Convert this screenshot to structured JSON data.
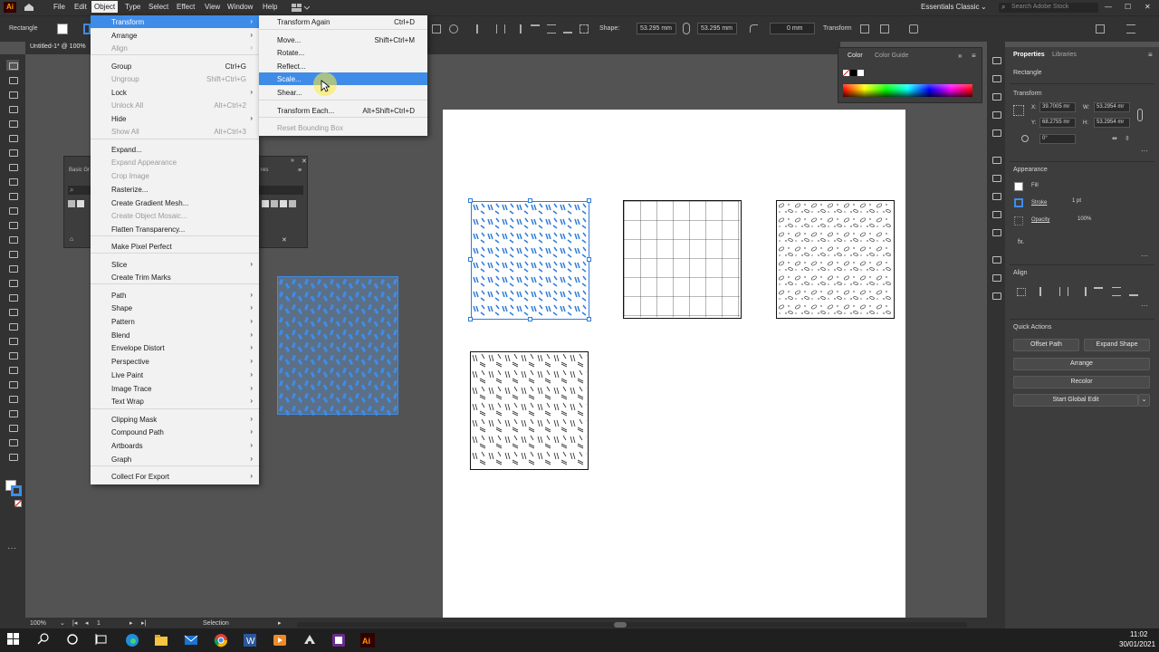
{
  "app": {
    "logo": "Ai",
    "workspace": "Essentials Classic",
    "search_placeholder": "Search Adobe Stock",
    "doc_tab": "Untitled-1* @ 100%"
  },
  "menubar": [
    "File",
    "Edit",
    "Object",
    "Type",
    "Select",
    "Effect",
    "View",
    "Window",
    "Help"
  ],
  "control": {
    "selection_type": "Rectangle",
    "shape_label": "Shape:",
    "w_value": "53.295 mm",
    "h_value": "53.295 mm",
    "corner_value": "0 mm",
    "transform_label": "Transform"
  },
  "object_menu": {
    "items": [
      {
        "label": "Transform",
        "shortcut": "",
        "arrow": "›",
        "state": "highlight"
      },
      {
        "label": "Arrange",
        "shortcut": "",
        "arrow": "›",
        "state": "normal"
      },
      {
        "label": "Align",
        "shortcut": "",
        "arrow": "›",
        "state": "disabled"
      },
      {
        "label": "Group",
        "shortcut": "Ctrl+G",
        "arrow": "",
        "state": "normal"
      },
      {
        "label": "Ungroup",
        "shortcut": "Shift+Ctrl+G",
        "arrow": "",
        "state": "disabled"
      },
      {
        "label": "Lock",
        "shortcut": "",
        "arrow": "›",
        "state": "normal"
      },
      {
        "label": "Unlock All",
        "shortcut": "Alt+Ctrl+2",
        "arrow": "",
        "state": "disabled"
      },
      {
        "label": "Hide",
        "shortcut": "",
        "arrow": "›",
        "state": "normal"
      },
      {
        "label": "Show All",
        "shortcut": "Alt+Ctrl+3",
        "arrow": "",
        "state": "disabled"
      },
      {
        "label": "Expand...",
        "shortcut": "",
        "arrow": "",
        "state": "normal"
      },
      {
        "label": "Expand Appearance",
        "shortcut": "",
        "arrow": "",
        "state": "disabled"
      },
      {
        "label": "Crop Image",
        "shortcut": "",
        "arrow": "",
        "state": "disabled"
      },
      {
        "label": "Rasterize...",
        "shortcut": "",
        "arrow": "",
        "state": "normal"
      },
      {
        "label": "Create Gradient Mesh...",
        "shortcut": "",
        "arrow": "",
        "state": "normal"
      },
      {
        "label": "Create Object Mosaic...",
        "shortcut": "",
        "arrow": "",
        "state": "disabled"
      },
      {
        "label": "Flatten Transparency...",
        "shortcut": "",
        "arrow": "",
        "state": "normal"
      },
      {
        "label": "Make Pixel Perfect",
        "shortcut": "",
        "arrow": "",
        "state": "normal"
      },
      {
        "label": "Slice",
        "shortcut": "",
        "arrow": "›",
        "state": "normal"
      },
      {
        "label": "Create Trim Marks",
        "shortcut": "",
        "arrow": "",
        "state": "normal"
      },
      {
        "label": "Path",
        "shortcut": "",
        "arrow": "›",
        "state": "normal"
      },
      {
        "label": "Shape",
        "shortcut": "",
        "arrow": "›",
        "state": "normal"
      },
      {
        "label": "Pattern",
        "shortcut": "",
        "arrow": "›",
        "state": "normal"
      },
      {
        "label": "Blend",
        "shortcut": "",
        "arrow": "›",
        "state": "normal"
      },
      {
        "label": "Envelope Distort",
        "shortcut": "",
        "arrow": "›",
        "state": "normal"
      },
      {
        "label": "Perspective",
        "shortcut": "",
        "arrow": "›",
        "state": "normal"
      },
      {
        "label": "Live Paint",
        "shortcut": "",
        "arrow": "›",
        "state": "normal"
      },
      {
        "label": "Image Trace",
        "shortcut": "",
        "arrow": "›",
        "state": "normal"
      },
      {
        "label": "Text Wrap",
        "shortcut": "",
        "arrow": "›",
        "state": "normal"
      },
      {
        "label": "Clipping Mask",
        "shortcut": "",
        "arrow": "›",
        "state": "normal"
      },
      {
        "label": "Compound Path",
        "shortcut": "",
        "arrow": "›",
        "state": "normal"
      },
      {
        "label": "Artboards",
        "shortcut": "",
        "arrow": "›",
        "state": "normal"
      },
      {
        "label": "Graph",
        "shortcut": "",
        "arrow": "›",
        "state": "normal"
      },
      {
        "label": "Collect For Export",
        "shortcut": "",
        "arrow": "›",
        "state": "normal"
      }
    ]
  },
  "transform_submenu": {
    "items": [
      {
        "label": "Transform Again",
        "shortcut": "Ctrl+D",
        "state": "normal"
      },
      {
        "label": "Move...",
        "shortcut": "Shift+Ctrl+M",
        "state": "normal"
      },
      {
        "label": "Rotate...",
        "shortcut": "",
        "state": "normal"
      },
      {
        "label": "Reflect...",
        "shortcut": "",
        "state": "normal"
      },
      {
        "label": "Scale...",
        "shortcut": "",
        "state": "highlight"
      },
      {
        "label": "Shear...",
        "shortcut": "",
        "state": "normal"
      },
      {
        "label": "Transform Each...",
        "shortcut": "Alt+Shift+Ctrl+D",
        "state": "normal"
      },
      {
        "label": "Reset Bounding Box",
        "shortcut": "",
        "state": "disabled"
      }
    ]
  },
  "color_panel": {
    "tab1": "Color",
    "tab2": "Color Guide"
  },
  "properties": {
    "tab1": "Properties",
    "tab2": "Libraries",
    "type": "Rectangle",
    "transform_heading": "Transform",
    "x_label": "X:",
    "x_value": "39.7005 mr",
    "y_label": "Y:",
    "y_value": "68.2755 mr",
    "w_label": "W:",
    "w_value": "53.2954 mr",
    "h_label": "H:",
    "h_value": "53.2954 mr",
    "angle_value": "0°",
    "appearance_heading": "Appearance",
    "fill_label": "Fill",
    "stroke_label": "Stroke",
    "stroke_value": "1 pt",
    "opacity_label": "Opacity",
    "opacity_value": "100%",
    "fx_label": "fx.",
    "align_heading": "Align",
    "quick_actions_heading": "Quick Actions",
    "btn_offset": "Offset Path",
    "btn_expand": "Expand Shape",
    "btn_arrange": "Arrange",
    "btn_recolor": "Recolor",
    "btn_global": "Start Global Edit"
  },
  "floating_panel": {
    "title": "Basic Gr",
    "title_right": "res"
  },
  "status": {
    "zoom": "100%",
    "artboard_num": "1",
    "tool": "Selection"
  },
  "taskbar": {
    "time": "11:02",
    "date": "30/01/2021"
  },
  "colors": {
    "accent": "#3f8ce8",
    "selection": "#2f7bd9"
  }
}
